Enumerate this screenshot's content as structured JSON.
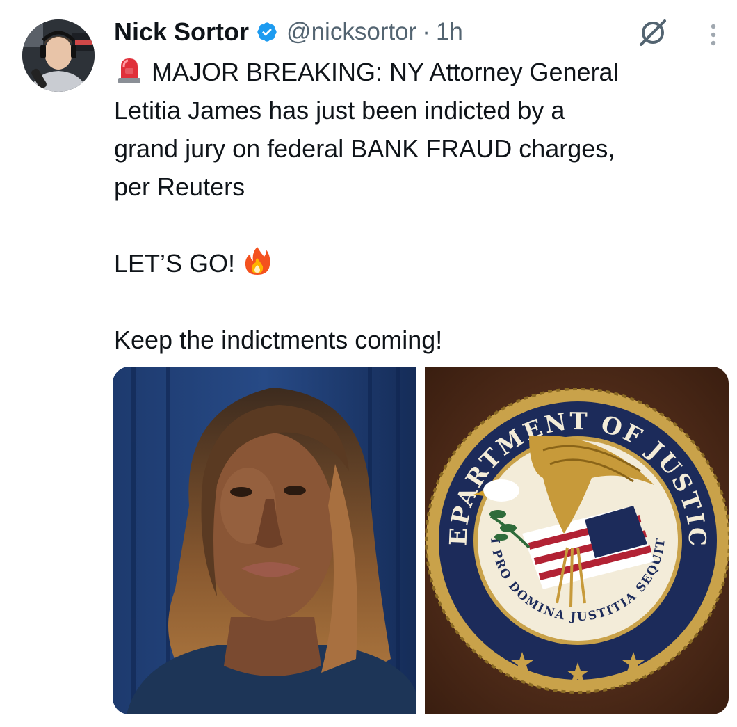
{
  "author": {
    "name": "Nick Sortor",
    "handle": "@nicksortor",
    "separator": "·",
    "time": "1h"
  },
  "tweet": {
    "line1": "MAJOR BREAKING: NY Attorney General",
    "line2": "Letitia James has just been indicted by a",
    "line3": "grand jury on federal BANK FRAUD charges,",
    "line4": "per Reuters",
    "line5": "LET’S GO!",
    "line6": "Keep the indictments coming!"
  },
  "media": {
    "seal_top": "DEPARTMENT OF JUSTICE",
    "seal_motto": "QUI PRO DOMINA JUSTITIA SEQUITUR"
  },
  "icons": {
    "verified": "verified-badge-icon",
    "grok": "grok-icon",
    "more": "more-options-icon",
    "siren": "police-light-emoji",
    "fire": "fire-emoji"
  },
  "colors": {
    "text": "#0f1419",
    "secondary": "#536471",
    "verified": "#1d9bf0"
  }
}
